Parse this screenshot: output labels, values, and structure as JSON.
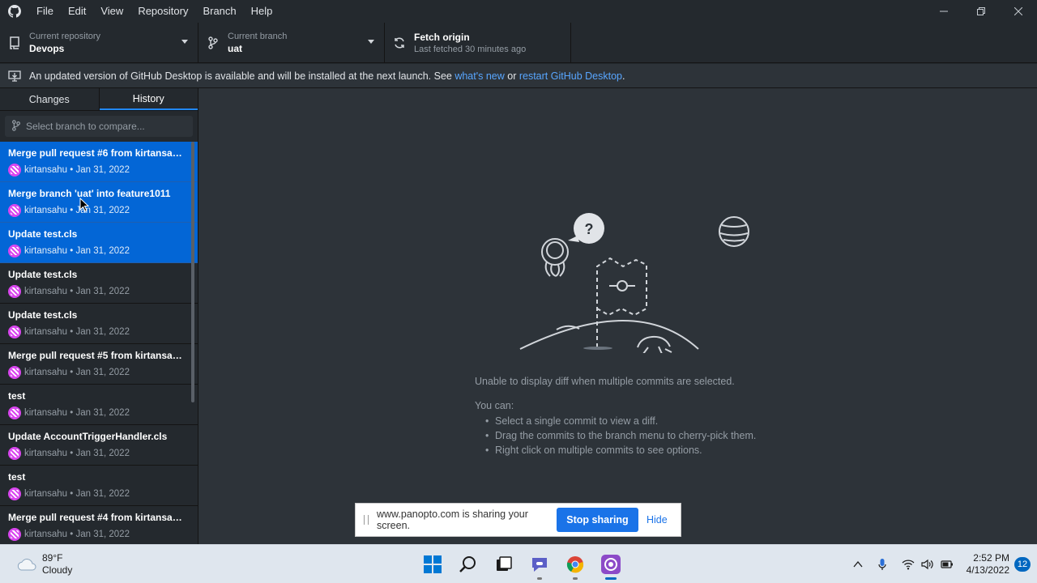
{
  "menu": [
    "File",
    "Edit",
    "View",
    "Repository",
    "Branch",
    "Help"
  ],
  "toolbar": {
    "repo_label": "Current repository",
    "repo_value": "Devops",
    "branch_label": "Current branch",
    "branch_value": "uat",
    "fetch_label": "Fetch origin",
    "fetch_sub": "Last fetched 30 minutes ago"
  },
  "banner": {
    "text_before": "An updated version of GitHub Desktop is available and will be installed at the next launch. See ",
    "link1": "what's new",
    "text_mid": " or ",
    "link2": "restart GitHub Desktop",
    "text_after": "."
  },
  "tabs": {
    "changes": "Changes",
    "history": "History"
  },
  "compare": {
    "placeholder": "Select branch to compare..."
  },
  "commits": [
    {
      "title": "Merge pull request #6 from kirtansah...",
      "author": "kirtansahu • Jan 31, 2022",
      "selected": true
    },
    {
      "title": "Merge branch 'uat' into feature1011",
      "author": "kirtansahu • Jan 31, 2022",
      "selected": true
    },
    {
      "title": "Update test.cls",
      "author": "kirtansahu • Jan 31, 2022",
      "selected": true
    },
    {
      "title": "Update test.cls",
      "author": "kirtansahu • Jan 31, 2022",
      "selected": false
    },
    {
      "title": "Update test.cls",
      "author": "kirtansahu • Jan 31, 2022",
      "selected": false
    },
    {
      "title": "Merge pull request #5 from kirtansah...",
      "author": "kirtansahu • Jan 31, 2022",
      "selected": false
    },
    {
      "title": "test",
      "author": "kirtansahu • Jan 31, 2022",
      "selected": false
    },
    {
      "title": "Update AccountTriggerHandler.cls",
      "author": "kirtansahu • Jan 31, 2022",
      "selected": false
    },
    {
      "title": "test",
      "author": "kirtansahu • Jan 31, 2022",
      "selected": false
    },
    {
      "title": "Merge pull request #4 from kirtansah...",
      "author": "kirtansahu • Jan 31, 2022",
      "selected": false
    }
  ],
  "main": {
    "message": "Unable to display diff when multiple commits are selected.",
    "you_can": "You can:",
    "tips": [
      "Select a single commit to view a diff.",
      "Drag the commits to the branch menu to cherry-pick them.",
      "Right click on multiple commits to see options."
    ]
  },
  "share": {
    "text": "www.panopto.com is sharing your screen.",
    "stop": "Stop sharing",
    "hide": "Hide"
  },
  "taskbar": {
    "temp": "89°F",
    "condition": "Cloudy",
    "time": "2:52 PM",
    "date": "4/13/2022",
    "notifications": "12"
  },
  "colors": {
    "accent": "#0366d6",
    "link": "#58a6ff",
    "bg": "#24292e",
    "panel": "#2d3339"
  }
}
